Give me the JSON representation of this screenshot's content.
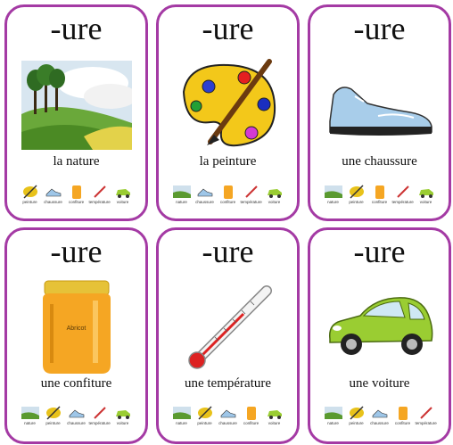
{
  "cards": [
    {
      "suffix": "-ure",
      "word": "la nature",
      "picture": "nature",
      "others": [
        "peinture",
        "chaussure",
        "confiture",
        "température",
        "voiture"
      ]
    },
    {
      "suffix": "-ure",
      "word": "la peinture",
      "picture": "palette",
      "others": [
        "nature",
        "chaussure",
        "confiture",
        "température",
        "voiture"
      ]
    },
    {
      "suffix": "-ure",
      "word": "une chaussure",
      "picture": "sneaker",
      "others": [
        "nature",
        "peinture",
        "confiture",
        "température",
        "voiture"
      ]
    },
    {
      "suffix": "-ure",
      "word": "une confiture",
      "picture": "jam-jar",
      "jar_label": "Abricot",
      "others": [
        "nature",
        "peinture",
        "chaussure",
        "température",
        "voiture"
      ]
    },
    {
      "suffix": "-ure",
      "word": "une température",
      "picture": "thermometer",
      "others": [
        "nature",
        "peinture",
        "chaussure",
        "confiture",
        "voiture"
      ]
    },
    {
      "suffix": "-ure",
      "word": "une voiture",
      "picture": "car",
      "others": [
        "nature",
        "peinture",
        "chaussure",
        "confiture",
        "température"
      ]
    }
  ],
  "colors": {
    "border": "#a43aa4",
    "car": "#9acd32",
    "jam": "#f5a623"
  }
}
